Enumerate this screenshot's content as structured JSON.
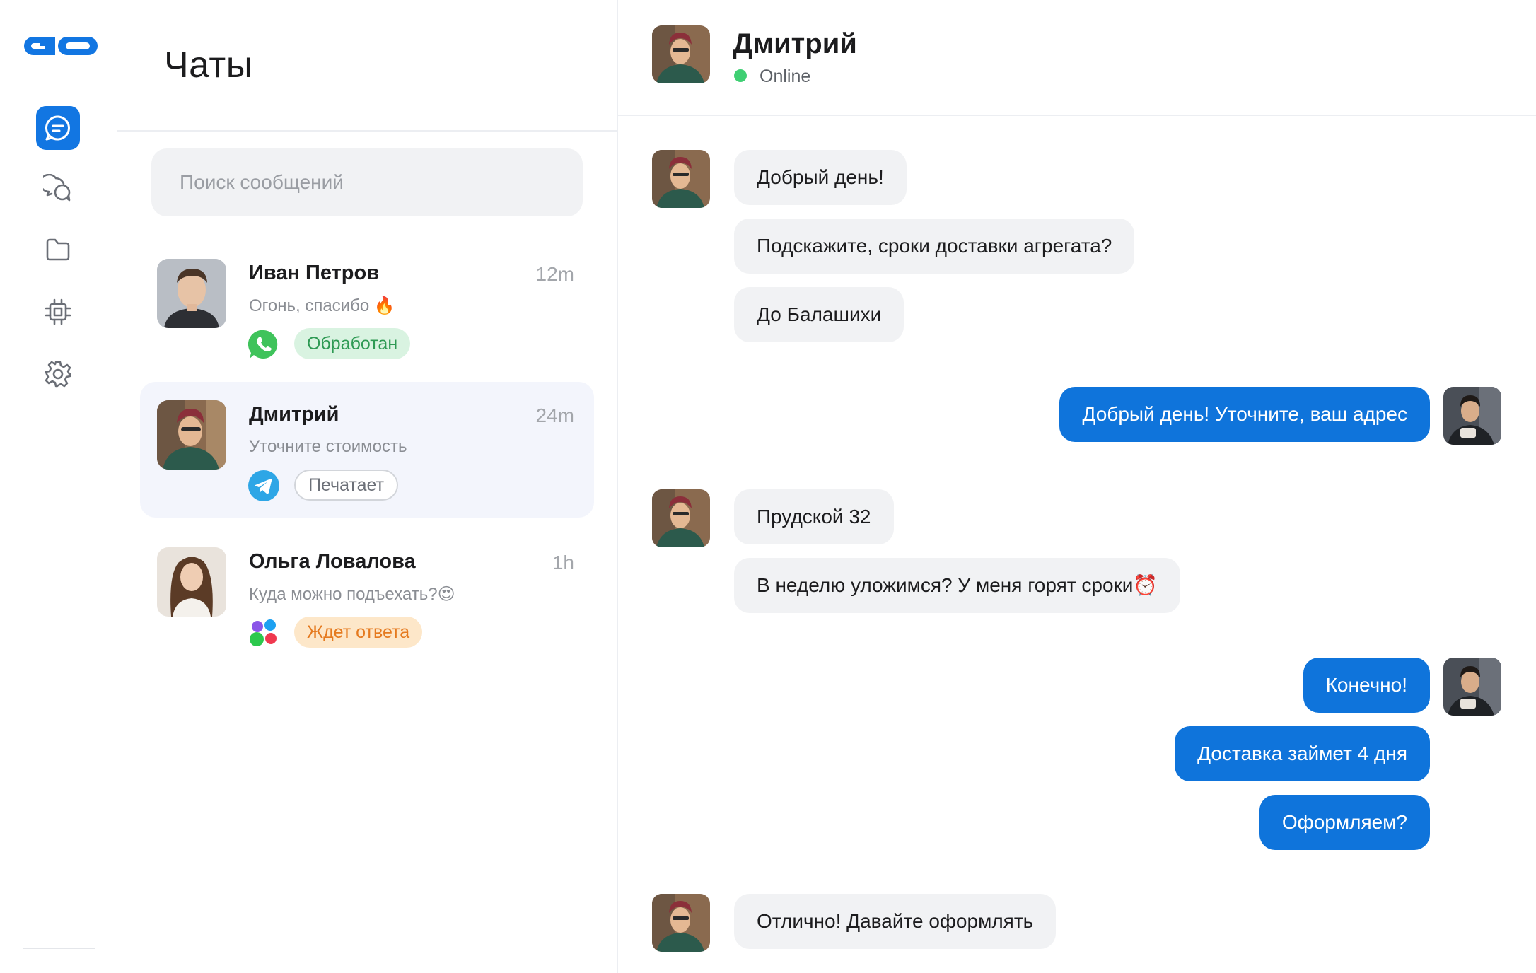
{
  "chats_title": "Чаты",
  "search": {
    "placeholder": "Поиск сообщений"
  },
  "chats": [
    {
      "name": "Иван Петров",
      "time": "12m",
      "preview": "Огонь, спасибо 🔥",
      "channel": "whatsapp-icon",
      "tag": "Обработан"
    },
    {
      "name": "Дмитрий",
      "time": "24m",
      "preview": "Уточните стоимость",
      "channel": "telegram-icon",
      "tag": "Печатает"
    },
    {
      "name": "Ольга Ловалова",
      "time": "1h",
      "preview": "Куда можно подъехать?😍",
      "channel": "multichannel-icon",
      "tag": "Ждет ответа"
    }
  ],
  "conversation": {
    "contact_name": "Дмитрий",
    "status": "Online",
    "messages": [
      {
        "from": "contact",
        "text": "Добрый день!"
      },
      {
        "from": "contact",
        "text": "Подскажите, сроки доставки агрегата?"
      },
      {
        "from": "contact",
        "text": "До Балашихи"
      },
      {
        "from": "operator",
        "text": "Добрый день! Уточните, ваш адрес"
      },
      {
        "from": "contact",
        "text": "Прудской 32"
      },
      {
        "from": "contact",
        "text": "В неделю уложимся? У меня горят сроки⏰"
      },
      {
        "from": "operator",
        "text": "Конечно!"
      },
      {
        "from": "operator",
        "text": "Доставка займет 4 дня"
      },
      {
        "from": "operator",
        "text": "Оформляем?"
      },
      {
        "from": "contact",
        "text": "Отлично! Давайте оформлять"
      }
    ]
  },
  "colors": {
    "accent": "#1276e2",
    "online": "#3fcf73",
    "tag_green": "#2e9a54",
    "tag_orange": "#e57a1f"
  }
}
